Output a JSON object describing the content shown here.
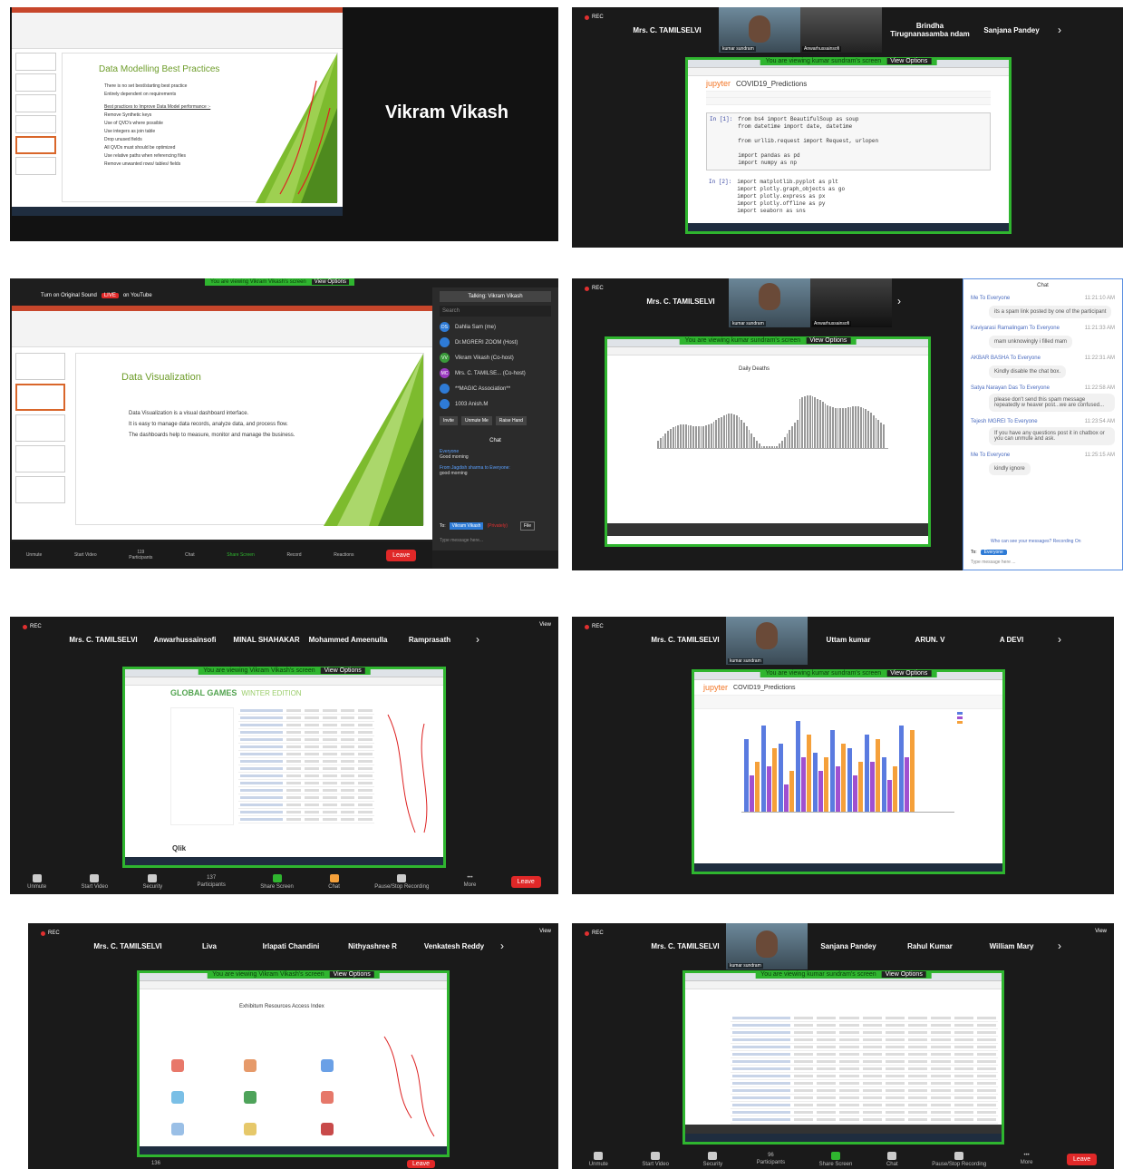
{
  "p1": {
    "slide_title": "Data Modelling Best Practices",
    "bullets": [
      "There is no set best/starting best practice",
      "Entirely dependent on requirements"
    ],
    "sub_heading": "Best practices to Improve Data Model performance :-",
    "sub_bullets": [
      "Remove Synthetic keys",
      "Use of QVD's where possible",
      "Use integers as join table",
      "Drop unused fields",
      "All QVDs must should be optimized",
      "Use relative paths when referencing files",
      "Remove unwanted rows/ tables/ fields"
    ],
    "presenter_name": "Vikram Vikash"
  },
  "p2": {
    "names": [
      "Mrs. C. TAMILSELVI",
      "Brindha Tirugnanasamba ndam",
      "Sanjana Pandey"
    ],
    "cam_label": "kumar sundram",
    "cam2_label": "Anwarhussainsofi",
    "banner": "You are viewing kumar sundram's screen",
    "view_options": "View Options",
    "nb_title": "COVID19_Predictions",
    "jupyter": "jupyter",
    "cells": [
      {
        "prompt": "In [1]:",
        "code": "from bs4 import BeautifulSoup as soup\nfrom datetime import date, datetime\n\nfrom urllib.request import Request, urlopen\n\nimport pandas as pd\nimport numpy as np"
      },
      {
        "prompt": "In [2]:",
        "code": "import matplotlib.pyplot as plt\nimport plotly.graph_objects as go\nimport plotly.express as px\nimport plotly.offline as py\nimport seaborn as sns"
      }
    ]
  },
  "p3": {
    "top_banner": "You are viewing Vikram Vikash's screen",
    "view_options": "View Options",
    "turn_on": "Turn on Original Sound",
    "live": "LIVE",
    "on_youtube": "on YouTube",
    "talking": "Talking: Vikram Vikash",
    "search": "Search",
    "participants": [
      {
        "initials": "DS",
        "name": "Dahlia Sam (me)"
      },
      {
        "initials": "",
        "name": "Dr.MGRERI ZOOM (Host)"
      },
      {
        "initials": "VV",
        "name": "Vikram Vikash (Co-host)"
      },
      {
        "initials": "MC",
        "name": "Mrs. C. TAMILSE... (Co-host)"
      },
      {
        "initials": "",
        "name": "**MAGIC Association**"
      },
      {
        "initials": "",
        "name": "1003 Anish.M"
      }
    ],
    "buttons": [
      "Invite",
      "Unmute Me",
      "Raise Hand"
    ],
    "chat_title": "Chat",
    "chat": [
      {
        "from": "Everyone",
        "msg": "Good morning"
      },
      {
        "from": "From Jagdish sharma to Everyone:",
        "msg": "good morning"
      }
    ],
    "to": "To:",
    "to_who": "Vikram Vikash",
    "privately": "(Privately)",
    "file": "File",
    "type_msg": "Type message here...",
    "slide_title": "Data Visualization",
    "slide_bullets": [
      "Data Visualization is a visual dashboard interface.",
      "It is easy to manage data records, analyze data, and process flow.",
      "The dashboards help to measure, monitor and manage the business."
    ],
    "count": "119",
    "bottom": [
      "Unmute",
      "Start Video",
      "Participants",
      "Chat",
      "Share Screen",
      "Record",
      "Reactions"
    ],
    "leave": "Leave"
  },
  "p4": {
    "names": [
      "Mrs. C. TAMILSELVI"
    ],
    "cam_label": "kumar sundram",
    "cam2_label": "Anwarhussainsofi",
    "banner": "You are viewing kumar sundram's screen",
    "view_options": "View Options",
    "chart_title": "Daily Deaths",
    "chat_title": "Chat",
    "chat": [
      {
        "from": "Me To Everyone",
        "time": "11:21:10 AM",
        "msg": "its a spam link posted by one of the participant"
      },
      {
        "from": "Kaviyarasi Ramalingam To Everyone",
        "time": "11:21:33 AM",
        "msg": "mam unknowingly i filled mam"
      },
      {
        "from": "AKBAR BASHA To Everyone",
        "time": "11:22:31 AM",
        "msg": "Kindly disable the chat box."
      },
      {
        "from": "Satya Narayan Das To Everyone",
        "time": "11:22:58 AM",
        "msg": "please don't send this spam message repeatedly w heaver post...we are confused..."
      },
      {
        "from": "Tejesh MGREI To Everyone",
        "time": "11:23:54 AM",
        "msg": "If you have any questions post it in chatbox or you can unmute and ask."
      },
      {
        "from": "Me To Everyone",
        "time": "11:25:15 AM",
        "msg": "kindly ignore"
      }
    ],
    "who_can_see": "Who can see your messages? Recording On",
    "to": "To:",
    "to_who": "Everyone",
    "type_msg": "Type message here ..."
  },
  "p5": {
    "names": [
      "Mrs. C. TAMILSELVI",
      "Anwarhussainsofi",
      "MINAL SHAHAKAR",
      "Mohammed Ameenulla",
      "Ramprasath"
    ],
    "view": "View",
    "banner": "You are viewing Vikram Vikash's screen",
    "view_options": "View Options",
    "app_title": "GLOBAL GAMES",
    "app_sub": "WINTER EDITION",
    "qlik": "Qlik",
    "bottom": [
      "Unmute",
      "Start Video",
      "Security",
      "Participants",
      "Share Screen",
      "Chat",
      "Pause/Stop Recording",
      "More"
    ],
    "count": "137",
    "leave": "Leave"
  },
  "p6": {
    "names": [
      "Mrs. C. TAMILSELVI",
      "Uttam kumar",
      "ARUN. V",
      "A DEVI"
    ],
    "cam_label": "kumar sundram",
    "banner": "You are viewing kumar sundram's screen",
    "view_options": "View Options",
    "nb_title": "COVID19_Predictions",
    "jupyter": "jupyter"
  },
  "p7": {
    "names": [
      "Mrs. C. TAMILSELVI",
      "Liva",
      "Irlapati Chandini",
      "Nithyashree R",
      "Venkatesh Reddy"
    ],
    "view": "View",
    "banner": "You are viewing Vikram Vikash's screen",
    "view_options": "View Options",
    "page_title": "Exhibitum Resources Access Index",
    "count": "136",
    "leave": "Leave"
  },
  "p8": {
    "names": [
      "Mrs. C. TAMILSELVI",
      "Sanjana Pandey",
      "Rahul Kumar",
      "William Mary"
    ],
    "cam_label": "kumar sundram",
    "view": "View",
    "banner": "You are viewing kumar sundram's screen",
    "view_options": "View Options",
    "count": "96",
    "bottom": [
      "Unmute",
      "Start Video",
      "Security",
      "Participants",
      "Share Screen",
      "Chat",
      "Pause/Stop Recording",
      "More"
    ],
    "leave": "Leave"
  },
  "colors": {
    "zoom_green": "#2fb52f",
    "leave_red": "#e02828",
    "slide_green": "#7dbb2e",
    "bar_blue": "#5a7be0",
    "bar_purple": "#a050d0",
    "bar_orange": "#f5a03a"
  }
}
